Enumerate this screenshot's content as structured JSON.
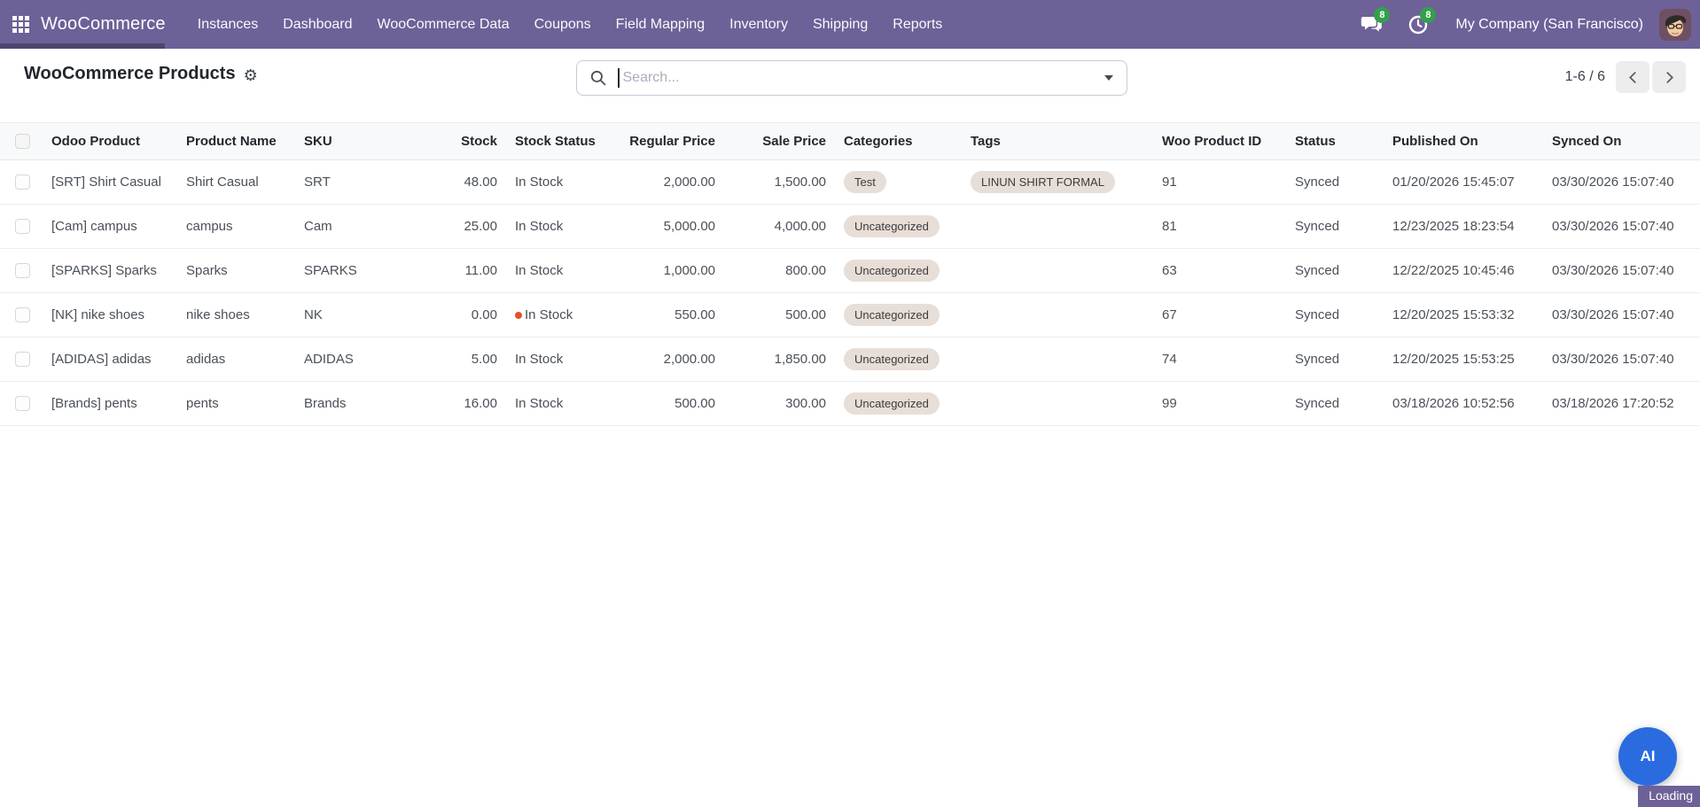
{
  "navbar": {
    "app_name": "WooCommerce",
    "menu_items": [
      "Instances",
      "Dashboard",
      "WooCommerce Data",
      "Coupons",
      "Field Mapping",
      "Inventory",
      "Shipping",
      "Reports"
    ],
    "messages_badge": "8",
    "activities_badge": "8",
    "company": "My Company (San Francisco)"
  },
  "control_panel": {
    "title": "WooCommerce Products",
    "search_placeholder": "Search...",
    "pager_range": "1-6 / 6"
  },
  "table": {
    "columns": [
      "Odoo Product",
      "Product Name",
      "SKU",
      "Stock",
      "Stock Status",
      "Regular Price",
      "Sale Price",
      "Categories",
      "Tags",
      "Woo Product ID",
      "Status",
      "Published On",
      "Synced On"
    ],
    "rows": [
      {
        "odoo_product": "[SRT] Shirt Casual",
        "product_name": "Shirt Casual",
        "sku": "SRT",
        "stock": "48.00",
        "stock_status": "In Stock",
        "stock_warning": false,
        "regular_price": "2,000.00",
        "sale_price": "1,500.00",
        "categories": [
          "Test"
        ],
        "tags": [
          "LINUN SHIRT FORMAL"
        ],
        "woo_product_id": "91",
        "status": "Synced",
        "published_on": "01/20/2026 15:45:07",
        "synced_on": "03/30/2026 15:07:40"
      },
      {
        "odoo_product": "[Cam] campus",
        "product_name": "campus",
        "sku": "Cam",
        "stock": "25.00",
        "stock_status": "In Stock",
        "stock_warning": false,
        "regular_price": "5,000.00",
        "sale_price": "4,000.00",
        "categories": [
          "Uncategorized"
        ],
        "tags": [],
        "woo_product_id": "81",
        "status": "Synced",
        "published_on": "12/23/2025 18:23:54",
        "synced_on": "03/30/2026 15:07:40"
      },
      {
        "odoo_product": "[SPARKS] Sparks",
        "product_name": "Sparks",
        "sku": "SPARKS",
        "stock": "11.00",
        "stock_status": "In Stock",
        "stock_warning": false,
        "regular_price": "1,000.00",
        "sale_price": "800.00",
        "categories": [
          "Uncategorized"
        ],
        "tags": [],
        "woo_product_id": "63",
        "status": "Synced",
        "published_on": "12/22/2025 10:45:46",
        "synced_on": "03/30/2026 15:07:40"
      },
      {
        "odoo_product": "[NK] nike shoes",
        "product_name": "nike shoes",
        "sku": "NK",
        "stock": "0.00",
        "stock_status": "In Stock",
        "stock_warning": true,
        "regular_price": "550.00",
        "sale_price": "500.00",
        "categories": [
          "Uncategorized"
        ],
        "tags": [],
        "woo_product_id": "67",
        "status": "Synced",
        "published_on": "12/20/2025 15:53:32",
        "synced_on": "03/30/2026 15:07:40"
      },
      {
        "odoo_product": "[ADIDAS] adidas",
        "product_name": "adidas",
        "sku": "ADIDAS",
        "stock": "5.00",
        "stock_status": "In Stock",
        "stock_warning": false,
        "regular_price": "2,000.00",
        "sale_price": "1,850.00",
        "categories": [
          "Uncategorized"
        ],
        "tags": [],
        "woo_product_id": "74",
        "status": "Synced",
        "published_on": "12/20/2025 15:53:25",
        "synced_on": "03/30/2026 15:07:40"
      },
      {
        "odoo_product": "[Brands] pents",
        "product_name": "pents",
        "sku": "Brands",
        "stock": "16.00",
        "stock_status": "In Stock",
        "stock_warning": false,
        "regular_price": "500.00",
        "sale_price": "300.00",
        "categories": [
          "Uncategorized"
        ],
        "tags": [],
        "woo_product_id": "99",
        "status": "Synced",
        "published_on": "03/18/2026 10:52:56",
        "synced_on": "03/18/2026 17:20:52"
      }
    ]
  },
  "floating": {
    "ai_button": "AI",
    "loading": "Loading"
  },
  "colors": {
    "navbar_purple": "#6d6198",
    "badge_green": "#33a04a",
    "pill_bg": "#e7ded8",
    "warning_dot": "#e4512a",
    "ai_button": "#2b6be0"
  }
}
